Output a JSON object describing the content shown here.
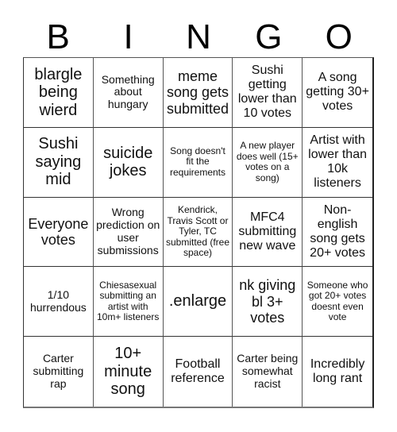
{
  "header": {
    "letters": [
      "B",
      "I",
      "N",
      "G",
      "O"
    ]
  },
  "cells": [
    "blargle being wierd",
    "Something about hungary",
    "meme song gets submitted",
    "Sushi getting lower than 10 votes",
    "A song getting 30+ votes",
    "Sushi saying mid",
    "suicide jokes",
    "Song doesn't fit the requirements",
    "A new player does well (15+ votes on a song)",
    "Artist with lower than 10k listeners",
    "Everyone votes",
    "Wrong prediction on user submissions",
    "Kendrick, Travis Scott or Tyler, TC submitted (free space)",
    "MFC4 submitting new wave",
    "Non-english song gets 20+ votes",
    "1/10 hurrendous",
    "Chiesasexual submitting an artist with 10m+ listeners",
    ".enlarge",
    "nk giving bl 3+ votes",
    "Someone who got 20+ votes doesnt even vote",
    "Carter submitting rap",
    "10+ minute song",
    "Football reference",
    "Carter being somewhat racist",
    "Incredibly long rant"
  ]
}
